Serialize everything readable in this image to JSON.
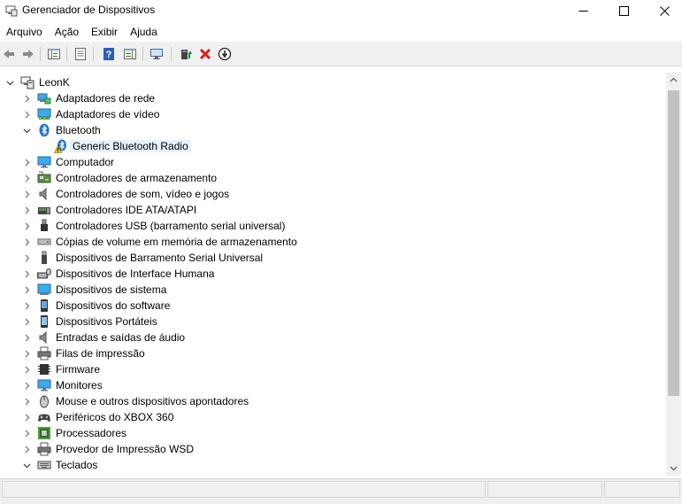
{
  "window": {
    "title": "Gerenciador de Dispositivos",
    "icon": "device-manager-icon",
    "controls": [
      "minimize-icon",
      "maximize-icon",
      "close-icon"
    ]
  },
  "menu": {
    "file": "Arquivo",
    "action": "Ação",
    "view": "Exibir",
    "help": "Ajuda"
  },
  "toolbar": {
    "buttons": [
      "back-arrow-icon",
      "forward-arrow-icon",
      "show-hide-tree-icon",
      "properties-icon",
      "help-icon",
      "action-pane-icon",
      "scan-hardware-icon",
      "update-driver-icon",
      "uninstall-device-icon",
      "disable-device-icon"
    ],
    "accent_colors": {
      "help": "#2b5fb6",
      "uninstall": "#e01b1b",
      "update": "#1e8b2e"
    }
  },
  "tree": {
    "root": "LeonK",
    "categories": [
      {
        "label": "Adaptadores de rede",
        "icon": "network-adapter-icon",
        "expanded": false
      },
      {
        "label": "Adaptadores de vídeo",
        "icon": "display-adapter-icon",
        "expanded": false
      },
      {
        "label": "Bluetooth",
        "icon": "bluetooth-icon",
        "expanded": true
      },
      {
        "label": "Computador",
        "icon": "computer-icon",
        "expanded": false
      },
      {
        "label": "Controladores de armazenamento",
        "icon": "storage-controller-icon",
        "expanded": false
      },
      {
        "label": "Controladores de som, vídeo e jogos",
        "icon": "speaker-icon",
        "expanded": false
      },
      {
        "label": "Controladores IDE ATA/ATAPI",
        "icon": "ide-controller-icon",
        "expanded": false
      },
      {
        "label": "Controladores USB (barramento serial universal)",
        "icon": "usb-icon",
        "expanded": false
      },
      {
        "label": "Cópias de volume em memória de armazenamento",
        "icon": "volume-shadow-icon",
        "expanded": false
      },
      {
        "label": "Dispositivos de Barramento Serial Universal",
        "icon": "usb-device-icon",
        "expanded": false
      },
      {
        "label": "Dispositivos de Interface Humana",
        "icon": "hid-icon",
        "expanded": false
      },
      {
        "label": "Dispositivos de sistema",
        "icon": "system-device-icon",
        "expanded": false
      },
      {
        "label": "Dispositivos do software",
        "icon": "software-device-icon",
        "expanded": false
      },
      {
        "label": "Dispositivos Portáteis",
        "icon": "portable-device-icon",
        "expanded": false
      },
      {
        "label": "Entradas e saídas de áudio",
        "icon": "audio-io-icon",
        "expanded": false
      },
      {
        "label": "Filas de impressão",
        "icon": "printer-queue-icon",
        "expanded": false
      },
      {
        "label": "Firmware",
        "icon": "firmware-icon",
        "expanded": false
      },
      {
        "label": "Monitores",
        "icon": "monitor-icon",
        "expanded": false
      },
      {
        "label": "Mouse e outros dispositivos apontadores",
        "icon": "mouse-icon",
        "expanded": false
      },
      {
        "label": "Periféricos do XBOX 360",
        "icon": "gamepad-icon",
        "expanded": false
      },
      {
        "label": "Processadores",
        "icon": "processor-icon",
        "expanded": false
      },
      {
        "label": "Provedor de Impressão WSD",
        "icon": "wsd-printer-icon",
        "expanded": false
      },
      {
        "label": "Teclados",
        "icon": "keyboard-icon",
        "expanded": true
      }
    ],
    "bluetooth_children": [
      {
        "label": "Generic Bluetooth Radio",
        "icon": "bluetooth-warning-icon",
        "selected": true
      }
    ]
  },
  "colors": {
    "selection": "#e5f3ff",
    "warning": "#f2c200",
    "bluetooth": "#1f6fd1"
  }
}
